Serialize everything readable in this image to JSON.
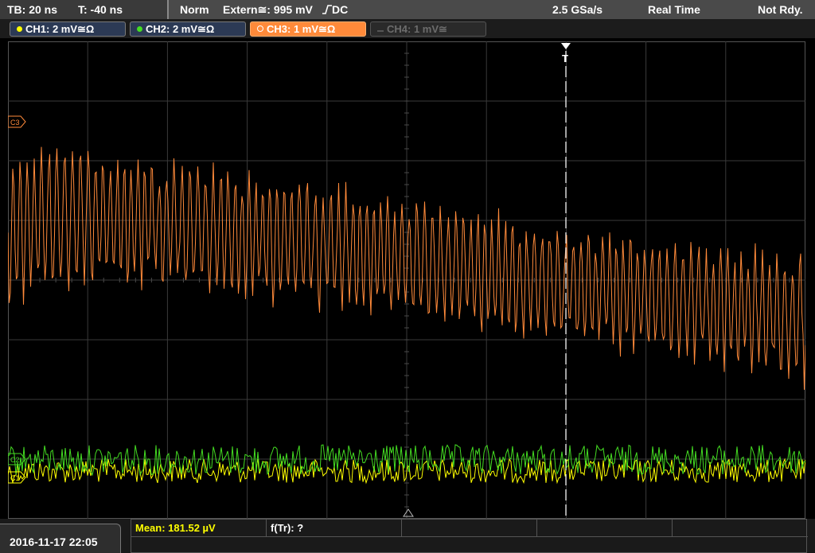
{
  "status": {
    "timebase": "TB: 20 ns",
    "trigger_time": "T: -40 ns",
    "mode": "Norm",
    "trigger_source": "Extern≅: 995 mV",
    "coupling": "DC",
    "sample_rate": "2.5 GSa/s",
    "acq_mode": "Real Time",
    "state": "Not Rdy."
  },
  "channels": [
    {
      "label": "CH1: 2 mV≅Ω",
      "color": "#ffff00",
      "state": "on"
    },
    {
      "label": "CH2: 2 mV≅Ω",
      "color": "#44dd22",
      "state": "on"
    },
    {
      "label": "CH3: 1 mV≅Ω",
      "color": "#ff8a3a",
      "state": "active"
    },
    {
      "label": "CH4: 1 mV≅",
      "color": "#6c6c6c",
      "state": "off"
    }
  ],
  "screen": {
    "trigger_marker": "T",
    "ch3_marker": "C3",
    "ch2_marker": "C2",
    "ch1_marker": "C1"
  },
  "footer": {
    "datetime": "2016-11-17 22:05",
    "measurement_1": "Mean: 181.52 µV",
    "measurement_2": "f(Tr): ?"
  },
  "colors": {
    "ch1": "#ffff00",
    "ch2": "#44dd22",
    "ch3": "#ff8a3a",
    "grid": "#3a3a3a"
  }
}
